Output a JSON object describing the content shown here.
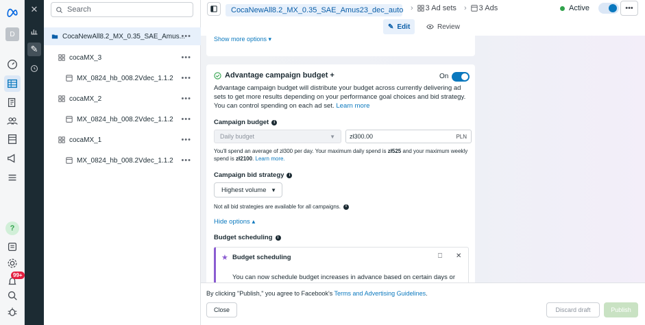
{
  "rail": {
    "profile_initial": "D",
    "notification_badge": "99+"
  },
  "tree": {
    "search_placeholder": "Search",
    "items": [
      {
        "label": "CocaNewAll8.2_MX_0.35_SAE_Amus...",
        "kind": "campaign"
      },
      {
        "label": "cocaMX_3",
        "kind": "adset"
      },
      {
        "label": "MX_0824_hb_008.2Vdec_1.1.2",
        "kind": "ad"
      },
      {
        "label": "cocaMX_2",
        "kind": "adset"
      },
      {
        "label": "MX_0824_hb_008.2Vdec_1.1.2",
        "kind": "ad"
      },
      {
        "label": "cocaMX_1",
        "kind": "adset"
      },
      {
        "label": "MX_0824_hb_008.2Vdec_1.1.2",
        "kind": "ad"
      }
    ],
    "more": "•••"
  },
  "topbar": {
    "campaign_crumb": "CocaNewAll8.2_MX_0.35_SAE_Amus23_dec_auto",
    "adsets_crumb": "3 Ad sets",
    "ads_crumb": "3 Ads",
    "status": "Active",
    "kebab": "•••",
    "edit_label": "Edit",
    "review_label": "Review"
  },
  "main": {
    "show_more": "Show more options ▾",
    "advantage": {
      "title": "Advantage campaign budget +",
      "toggle_label": "On",
      "description": "Advantage campaign budget will distribute your budget across currently delivering ad sets to get more results depending on your performance goal choices and bid strategy. You can control spending on each ad set.",
      "learn_more": "Learn more"
    },
    "budget": {
      "label": "Campaign budget",
      "type": "Daily budget",
      "amount": "zł300.00",
      "currency": "PLN",
      "note_prefix": "You'll spend an average of zł300 per day. Your maximum daily spend is ",
      "max_daily": "zł525",
      "note_mid": " and your maximum weekly spend is ",
      "max_weekly": "zł2100",
      "note_end": ".",
      "learn_more": "Learn more."
    },
    "bid": {
      "label": "Campaign bid strategy",
      "value": "Highest volume",
      "note": "Not all bid strategies are available for all campaigns."
    },
    "hide_options": "Hide options ▴",
    "scheduling": {
      "label": "Budget scheduling",
      "notice_title": "Budget scheduling",
      "notice_text": "You can now schedule budget increases in advance based on certain days or times when you anticipate higher sales opportunities, peak traffic periods or"
    }
  },
  "footer": {
    "consent_prefix": "By clicking \"Publish,\" you agree to Facebook's ",
    "consent_link": "Terms and Advertising Guidelines",
    "consent_end": ".",
    "close_label": "Close",
    "discard_label": "Discard draft",
    "publish_label": "Publish"
  },
  "colors": {
    "accent": "#0a78be",
    "active_dot": "#31a24c",
    "badge": "#e41e3f",
    "notice_accent": "#8a5cd1"
  }
}
